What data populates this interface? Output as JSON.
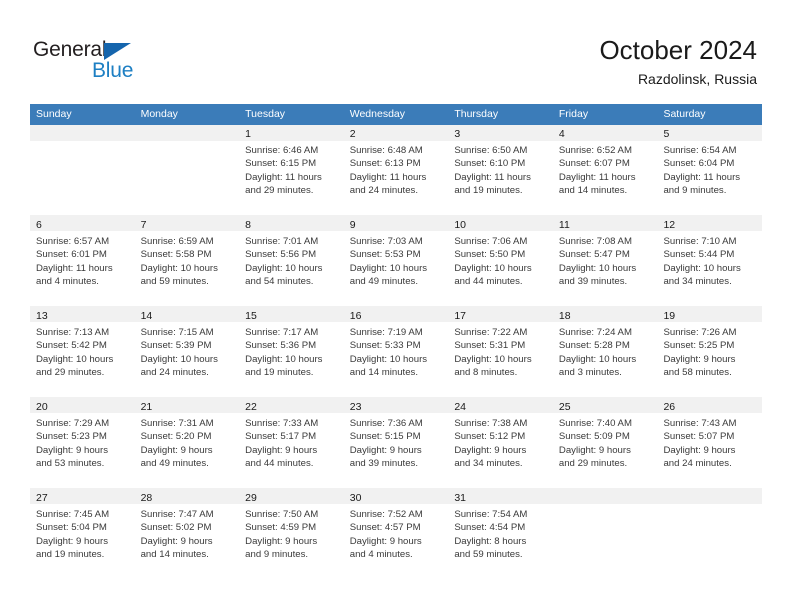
{
  "brand": {
    "name_part1": "General",
    "name_part2": "Blue",
    "triangle_icon": "triangle-icon",
    "color_dark": "#231f20",
    "color_blue": "#1d7fc3"
  },
  "header": {
    "month_title": "October 2024",
    "location": "Razdolinsk, Russia"
  },
  "theme": {
    "header_blue": "#3b7cb9",
    "row_separator": "#3b7cb9",
    "date_band": "#f1f1f1",
    "text": "#3a3a3a"
  },
  "calendar": {
    "weekdays": [
      "Sunday",
      "Monday",
      "Tuesday",
      "Wednesday",
      "Thursday",
      "Friday",
      "Saturday"
    ],
    "weeks": [
      [
        {
          "day": "",
          "info": ""
        },
        {
          "day": "",
          "info": ""
        },
        {
          "day": "1",
          "info": "Sunrise: 6:46 AM\nSunset: 6:15 PM\nDaylight: 11 hours\nand 29 minutes."
        },
        {
          "day": "2",
          "info": "Sunrise: 6:48 AM\nSunset: 6:13 PM\nDaylight: 11 hours\nand 24 minutes."
        },
        {
          "day": "3",
          "info": "Sunrise: 6:50 AM\nSunset: 6:10 PM\nDaylight: 11 hours\nand 19 minutes."
        },
        {
          "day": "4",
          "info": "Sunrise: 6:52 AM\nSunset: 6:07 PM\nDaylight: 11 hours\nand 14 minutes."
        },
        {
          "day": "5",
          "info": "Sunrise: 6:54 AM\nSunset: 6:04 PM\nDaylight: 11 hours\nand 9 minutes."
        }
      ],
      [
        {
          "day": "6",
          "info": "Sunrise: 6:57 AM\nSunset: 6:01 PM\nDaylight: 11 hours\nand 4 minutes."
        },
        {
          "day": "7",
          "info": "Sunrise: 6:59 AM\nSunset: 5:58 PM\nDaylight: 10 hours\nand 59 minutes."
        },
        {
          "day": "8",
          "info": "Sunrise: 7:01 AM\nSunset: 5:56 PM\nDaylight: 10 hours\nand 54 minutes."
        },
        {
          "day": "9",
          "info": "Sunrise: 7:03 AM\nSunset: 5:53 PM\nDaylight: 10 hours\nand 49 minutes."
        },
        {
          "day": "10",
          "info": "Sunrise: 7:06 AM\nSunset: 5:50 PM\nDaylight: 10 hours\nand 44 minutes."
        },
        {
          "day": "11",
          "info": "Sunrise: 7:08 AM\nSunset: 5:47 PM\nDaylight: 10 hours\nand 39 minutes."
        },
        {
          "day": "12",
          "info": "Sunrise: 7:10 AM\nSunset: 5:44 PM\nDaylight: 10 hours\nand 34 minutes."
        }
      ],
      [
        {
          "day": "13",
          "info": "Sunrise: 7:13 AM\nSunset: 5:42 PM\nDaylight: 10 hours\nand 29 minutes."
        },
        {
          "day": "14",
          "info": "Sunrise: 7:15 AM\nSunset: 5:39 PM\nDaylight: 10 hours\nand 24 minutes."
        },
        {
          "day": "15",
          "info": "Sunrise: 7:17 AM\nSunset: 5:36 PM\nDaylight: 10 hours\nand 19 minutes."
        },
        {
          "day": "16",
          "info": "Sunrise: 7:19 AM\nSunset: 5:33 PM\nDaylight: 10 hours\nand 14 minutes."
        },
        {
          "day": "17",
          "info": "Sunrise: 7:22 AM\nSunset: 5:31 PM\nDaylight: 10 hours\nand 8 minutes."
        },
        {
          "day": "18",
          "info": "Sunrise: 7:24 AM\nSunset: 5:28 PM\nDaylight: 10 hours\nand 3 minutes."
        },
        {
          "day": "19",
          "info": "Sunrise: 7:26 AM\nSunset: 5:25 PM\nDaylight: 9 hours\nand 58 minutes."
        }
      ],
      [
        {
          "day": "20",
          "info": "Sunrise: 7:29 AM\nSunset: 5:23 PM\nDaylight: 9 hours\nand 53 minutes."
        },
        {
          "day": "21",
          "info": "Sunrise: 7:31 AM\nSunset: 5:20 PM\nDaylight: 9 hours\nand 49 minutes."
        },
        {
          "day": "22",
          "info": "Sunrise: 7:33 AM\nSunset: 5:17 PM\nDaylight: 9 hours\nand 44 minutes."
        },
        {
          "day": "23",
          "info": "Sunrise: 7:36 AM\nSunset: 5:15 PM\nDaylight: 9 hours\nand 39 minutes."
        },
        {
          "day": "24",
          "info": "Sunrise: 7:38 AM\nSunset: 5:12 PM\nDaylight: 9 hours\nand 34 minutes."
        },
        {
          "day": "25",
          "info": "Sunrise: 7:40 AM\nSunset: 5:09 PM\nDaylight: 9 hours\nand 29 minutes."
        },
        {
          "day": "26",
          "info": "Sunrise: 7:43 AM\nSunset: 5:07 PM\nDaylight: 9 hours\nand 24 minutes."
        }
      ],
      [
        {
          "day": "27",
          "info": "Sunrise: 7:45 AM\nSunset: 5:04 PM\nDaylight: 9 hours\nand 19 minutes."
        },
        {
          "day": "28",
          "info": "Sunrise: 7:47 AM\nSunset: 5:02 PM\nDaylight: 9 hours\nand 14 minutes."
        },
        {
          "day": "29",
          "info": "Sunrise: 7:50 AM\nSunset: 4:59 PM\nDaylight: 9 hours\nand 9 minutes."
        },
        {
          "day": "30",
          "info": "Sunrise: 7:52 AM\nSunset: 4:57 PM\nDaylight: 9 hours\nand 4 minutes."
        },
        {
          "day": "31",
          "info": "Sunrise: 7:54 AM\nSunset: 4:54 PM\nDaylight: 8 hours\nand 59 minutes."
        },
        {
          "day": "",
          "info": ""
        },
        {
          "day": "",
          "info": ""
        }
      ]
    ]
  }
}
